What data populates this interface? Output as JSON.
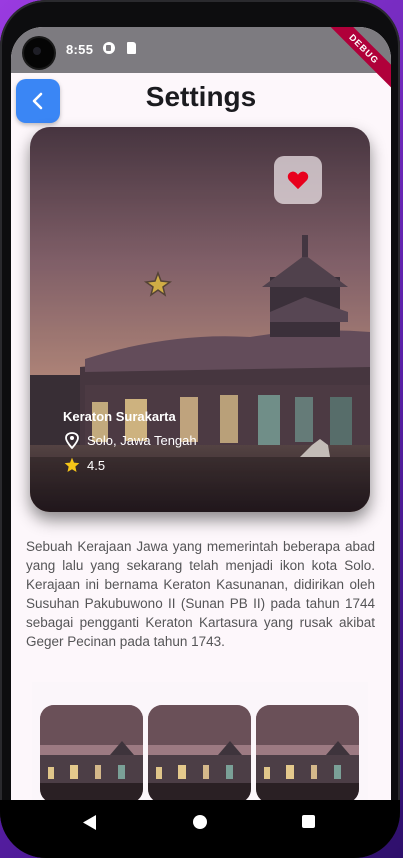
{
  "status_bar": {
    "time": "8:55",
    "debug_banner": "DEBUG"
  },
  "header": {
    "title": "Settings"
  },
  "place": {
    "name": "Keraton Surakarta",
    "location": "Solo, Jawa Tengah",
    "rating": "4.5"
  },
  "description": "Sebuah Kerajaan Jawa yang memerintah beberapa abad yang lalu yang sekarang telah menjadi ikon kota Solo. Kerajaan ini bernama Keraton Kasunanan, didirikan oleh Susuhan Pakubuwono II (Sunan PB II) pada tahun 1744 sebagai pengganti Keraton Kartasura yang rusak akibat Geger Pecinan pada tahun 1743.",
  "colors": {
    "accent": "#3a86f5",
    "favorite": "#e8001c",
    "rating_star": "#f5c518"
  },
  "icons": [
    "chevron-left-icon",
    "heart-icon",
    "location-pin-icon",
    "star-icon",
    "nav-back-icon",
    "nav-home-icon",
    "nav-recent-icon"
  ]
}
